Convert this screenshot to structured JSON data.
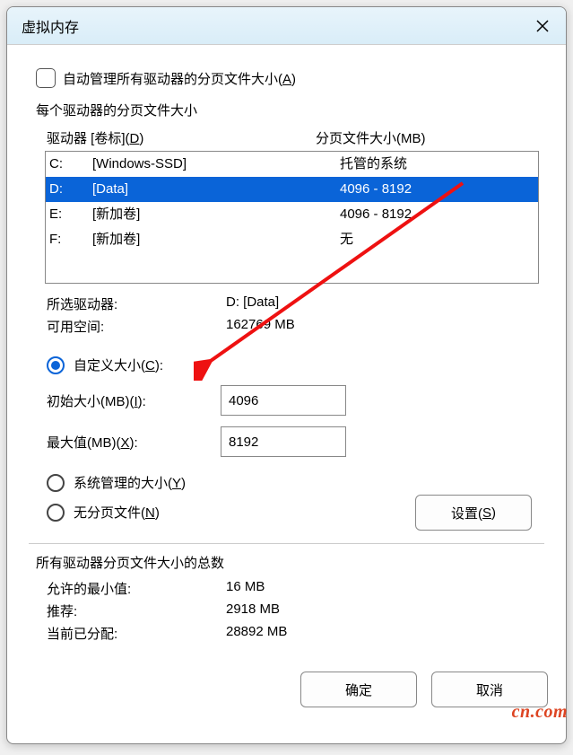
{
  "title": "虚拟内存",
  "auto_manage_label": "自动管理所有驱动器的分页文件大小(A)",
  "per_drive_label": "每个驱动器的分页文件大小",
  "header": {
    "drive": "驱动器 [卷标](D)",
    "size": "分页文件大小(MB)"
  },
  "drives": [
    {
      "letter": "C:",
      "label": "[Windows-SSD]",
      "size": "托管的系统",
      "selected": false
    },
    {
      "letter": "D:",
      "label": "[Data]",
      "size": "4096 - 8192",
      "selected": true
    },
    {
      "letter": "E:",
      "label": "[新加卷]",
      "size": "4096 - 8192",
      "selected": false
    },
    {
      "letter": "F:",
      "label": "[新加卷]",
      "size": "无",
      "selected": false
    }
  ],
  "selected": {
    "drive_label": "所选驱动器:",
    "drive_value": "D:  [Data]",
    "space_label": "可用空间:",
    "space_value": "162769 MB"
  },
  "radios": {
    "custom": "自定义大小(C):",
    "system": "系统管理的大小(Y)",
    "none": "无分页文件(N)"
  },
  "fields": {
    "initial_label": "初始大小(MB)(I):",
    "initial_value": "4096",
    "max_label": "最大值(MB)(X):",
    "max_value": "8192"
  },
  "set_button": "设置(S)",
  "totals": {
    "heading": "所有驱动器分页文件大小的总数",
    "min_label": "允许的最小值:",
    "min_value": "16 MB",
    "rec_label": "推荐:",
    "rec_value": "2918 MB",
    "cur_label": "当前已分配:",
    "cur_value": "28892 MB"
  },
  "buttons": {
    "ok": "确定",
    "cancel": "取消"
  },
  "watermark": "cn.com"
}
